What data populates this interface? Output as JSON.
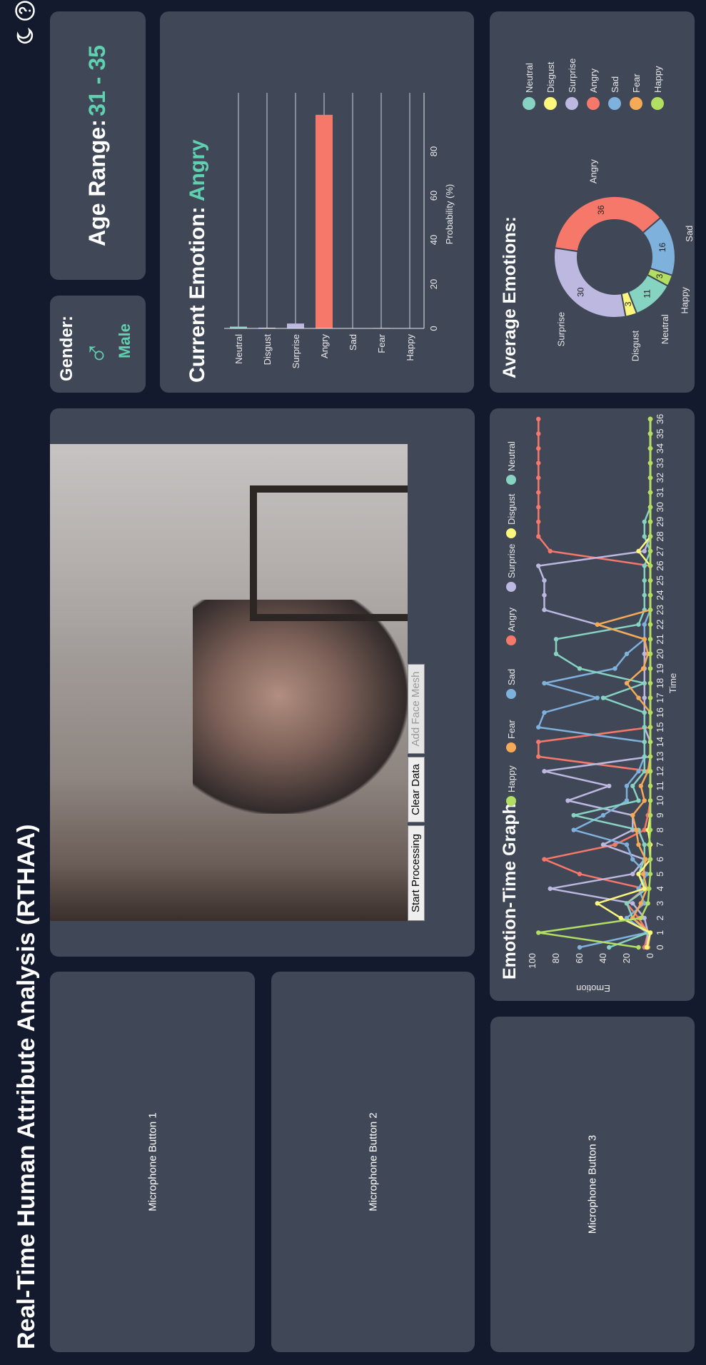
{
  "app": {
    "title": "Real-Time Human Attribute Analysis (RTHAA)"
  },
  "header_icons": [
    "theme-moon-icon",
    "help-question-icon"
  ],
  "microphones": [
    "Microphone Button 1",
    "Microphone Button 2",
    "Microphone Button 3"
  ],
  "video": {
    "buttons": {
      "start": "Start Processing",
      "clear": "Clear Data",
      "mesh": "Add Face Mesh"
    }
  },
  "gender": {
    "label": "Gender:",
    "symbol": "♂",
    "value": "Male"
  },
  "age": {
    "label": "Age Range:",
    "value": "31 - 35"
  },
  "current_emotion": {
    "label": "Current Emotion:",
    "value": "Angry"
  },
  "colors": {
    "Neutral": "#87d3c1",
    "Disgust": "#fbf77d",
    "Surprise": "#bdb8e0",
    "Angry": "#f6786a",
    "Sad": "#7fb1dd",
    "Fear": "#f5aa58",
    "Happy": "#b2de62",
    "accent": "#5fd0b0"
  },
  "chart_data": [
    {
      "type": "bar",
      "title": "Current Emotion",
      "categories": [
        "Neutral",
        "Disgust",
        "Surprise",
        "Angry",
        "Sad",
        "Fear",
        "Happy"
      ],
      "values": [
        0.8,
        0.3,
        2.2,
        96.5,
        0.1,
        0.2,
        0.0
      ],
      "xlabel": "Probability (%)",
      "ticks": [
        0,
        20,
        40,
        60,
        80
      ],
      "xlim": [
        0,
        100
      ],
      "legend": [
        "Neutral",
        "Disgust",
        "Surprise",
        "Angry",
        "Sad",
        "Fear",
        "Happy"
      ]
    },
    {
      "type": "pie",
      "title": "Average Emotions:",
      "slices": [
        {
          "label": "Angry",
          "value": 36
        },
        {
          "label": "Sad",
          "value": 16
        },
        {
          "label": "Happy",
          "value": 3
        },
        {
          "label": "Neutral",
          "value": 11
        },
        {
          "label": "Disgust",
          "value": 3
        },
        {
          "label": "Surprise",
          "value": 30
        }
      ],
      "legend": [
        "Neutral",
        "Disgust",
        "Surprise",
        "Angry",
        "Sad",
        "Fear",
        "Happy"
      ]
    },
    {
      "type": "line",
      "title": "Emotion-Time Graph:",
      "xlabel": "Time",
      "ylabel": "Emotion",
      "ylim": [
        0,
        100
      ],
      "yticks": [
        0,
        20,
        40,
        60,
        80,
        100
      ],
      "x": [
        0,
        1,
        2,
        3,
        4,
        5,
        6,
        7,
        8,
        9,
        10,
        11,
        12,
        13,
        14,
        15,
        16,
        17,
        18,
        19,
        20,
        21,
        22,
        23,
        24,
        25,
        26,
        27,
        28,
        29,
        30,
        31,
        32,
        33,
        34,
        35,
        36
      ],
      "legend": [
        "Happy",
        "Fear",
        "Sad",
        "Angry",
        "Surprise",
        "Disgust",
        "Neutral"
      ],
      "series": [
        {
          "name": "Happy",
          "values": [
            10,
            95,
            8,
            2,
            1,
            0,
            0,
            1,
            0,
            0,
            0,
            0,
            0,
            0,
            0,
            0,
            0,
            0,
            0,
            0,
            0,
            0,
            0,
            0,
            0,
            0,
            0,
            0,
            0,
            0,
            0,
            0,
            0,
            0,
            0,
            0,
            0
          ]
        },
        {
          "name": "Fear",
          "values": [
            2,
            0,
            15,
            8,
            3,
            6,
            4,
            10,
            12,
            15,
            5,
            8,
            2,
            0,
            0,
            0,
            0,
            10,
            20,
            6,
            2,
            5,
            45,
            0,
            0,
            0,
            0,
            0,
            0,
            0,
            0,
            0,
            0,
            0,
            0,
            0,
            0
          ]
        },
        {
          "name": "Sad",
          "values": [
            60,
            3,
            20,
            5,
            10,
            3,
            15,
            20,
            65,
            40,
            20,
            20,
            10,
            5,
            5,
            95,
            90,
            45,
            90,
            30,
            20,
            5,
            5,
            0,
            0,
            0,
            0,
            0,
            0,
            0,
            0,
            0,
            0,
            0,
            0,
            0,
            0
          ]
        },
        {
          "name": "Angry",
          "values": [
            5,
            2,
            10,
            20,
            5,
            60,
            90,
            30,
            5,
            2,
            0,
            0,
            0,
            95,
            95,
            0,
            0,
            0,
            0,
            0,
            0,
            0,
            0,
            0,
            0,
            0,
            0,
            85,
            95,
            95,
            95,
            95,
            95,
            95,
            95,
            95,
            95
          ]
        },
        {
          "name": "Surprise",
          "values": [
            3,
            2,
            5,
            15,
            85,
            15,
            5,
            40,
            15,
            15,
            70,
            35,
            90,
            0,
            0,
            5,
            5,
            5,
            5,
            5,
            5,
            5,
            45,
            90,
            90,
            90,
            95,
            5,
            0,
            0,
            0,
            0,
            0,
            0,
            0,
            0,
            0
          ]
        },
        {
          "name": "Disgust",
          "values": [
            3,
            0,
            25,
            45,
            5,
            10,
            0,
            0,
            2,
            0,
            0,
            0,
            0,
            0,
            0,
            0,
            0,
            0,
            0,
            0,
            0,
            0,
            0,
            0,
            0,
            0,
            0,
            10,
            0,
            0,
            0,
            0,
            0,
            0,
            0,
            0,
            0
          ]
        },
        {
          "name": "Neutral",
          "values": [
            35,
            2,
            15,
            20,
            3,
            10,
            5,
            5,
            10,
            65,
            10,
            15,
            5,
            5,
            5,
            5,
            5,
            40,
            5,
            60,
            80,
            80,
            10,
            5,
            5,
            5,
            5,
            0,
            5,
            5,
            0,
            0,
            0,
            0,
            0,
            0,
            0
          ]
        }
      ]
    }
  ]
}
